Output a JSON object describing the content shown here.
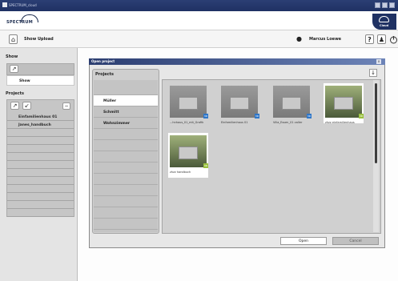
{
  "window": {
    "title": "SPECTRUM_cloud"
  },
  "brand": {
    "logo_text": "SPECTRUM",
    "corner_text": "Cloud"
  },
  "toolbar": {
    "module_label": "Show Upload",
    "user_name": "Marcus Loewe",
    "help_label": "?"
  },
  "sidebar": {
    "show_title": "Show",
    "show_item": "Show",
    "projects_title": "Projects",
    "projects": [
      "Einfamilienhaus 01",
      "Janes_handbuch",
      "",
      "",
      "",
      "",
      "",
      "",
      "",
      "",
      "",
      "",
      ""
    ]
  },
  "dialog": {
    "title": "Open project",
    "close": "x",
    "projects_header": "Projects",
    "project_list": [
      "",
      "Müller",
      "Schmitt",
      "Wohnzimmer",
      "",
      "",
      "",
      "",
      "",
      "",
      "",
      "",
      ""
    ],
    "selected_index": 1,
    "thumbnails": [
      {
        "label": "...hnhaus_01_mit_Grafik",
        "badge": "3D"
      },
      {
        "label": "Einfamilienhaus 01",
        "badge": "3D"
      },
      {
        "label": "Villa_Essen_01 voller",
        "badge": "3D"
      },
      {
        "label": "zhzz einfamilienhaus",
        "badge": "3D"
      },
      {
        "label": "zhzz handbuch",
        "badge": "3D"
      }
    ],
    "open_label": "Open",
    "cancel_label": "Cancel"
  }
}
